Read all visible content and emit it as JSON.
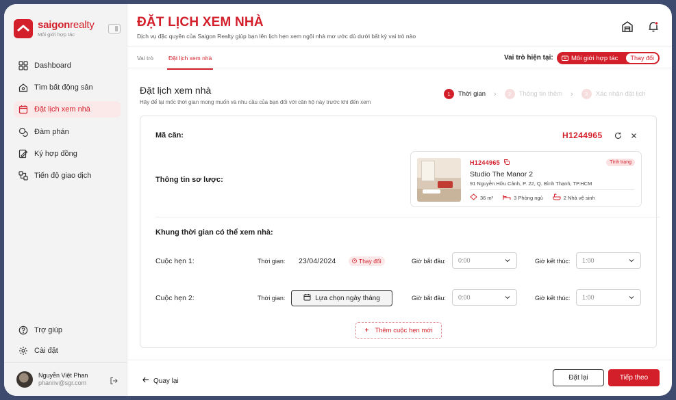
{
  "sidebar": {
    "brand_bold": "saigon",
    "brand_light": "realty",
    "brand_sub": "Môi giới hợp tác",
    "nav": [
      {
        "label": "Dashboard",
        "icon": "grid-icon"
      },
      {
        "label": "Tìm bất động sản",
        "icon": "house-search-icon"
      },
      {
        "label": "Đặt lịch xem nhà",
        "icon": "calendar-icon",
        "active": true
      },
      {
        "label": "Đàm phán",
        "icon": "chat-icon"
      },
      {
        "label": "Ký hợp đồng",
        "icon": "signature-icon"
      },
      {
        "label": "Tiến độ giao dịch",
        "icon": "progress-icon"
      }
    ],
    "bottom": [
      {
        "label": "Trợ giúp",
        "icon": "help-icon"
      },
      {
        "label": "Cài đặt",
        "icon": "gear-icon"
      }
    ],
    "user": {
      "name": "Nguyễn Việt Phan",
      "email": "phannv@sgr.com"
    }
  },
  "header": {
    "title": "ĐẶT LỊCH XEM NHÀ",
    "subtitle": "Dịch vụ đặc quyền của Saigon Realty giúp bạn lên lịch hẹn xem ngôi nhà mơ ước dù dưới bất kỳ vai trò nào"
  },
  "tabs": [
    {
      "label": "Vai trò"
    },
    {
      "label": "Đặt lịch xem nhà",
      "active": true
    }
  ],
  "role": {
    "label": "Vai trò hiện tại:",
    "value": "Môi giới hợp tác",
    "change": "Thay đổi"
  },
  "section": {
    "title": "Đặt lịch xem nhà",
    "subtitle": "Hãy để lại mốc thời gian mong muốn và nhu cầu của bạn đối với căn hộ này trước khi đến xem"
  },
  "steps": [
    {
      "num": "1",
      "label": "Thời gian",
      "active": true
    },
    {
      "num": "2",
      "label": "Thông tin thêm",
      "active": false
    },
    {
      "num": "3",
      "label": "Xác nhận đặt lịch",
      "active": false
    }
  ],
  "form": {
    "code_label": "Mã căn:",
    "code_value": "H1244965",
    "info_label": "Thông tin sơ lược:",
    "property": {
      "code": "H1244965",
      "badge": "Tình trạng",
      "name": "Studio The Manor 2",
      "address": "91 Nguyễn Hữu Cảnh, P. 22, Q. Bình Thạnh, TP.HCM",
      "area": "36 m²",
      "bedrooms": "3 Phòng ngủ",
      "bathrooms": "2 Nhà vệ sinh"
    },
    "slots_label": "Khung thời gian có thể xem nhà:",
    "appointments": [
      {
        "label": "Cuộc hẹn 1:",
        "time_label": "Thời gian:",
        "date": "23/04/2024",
        "change": "Thay đổi",
        "start_label": "Giờ bắt đầu:",
        "start_value": "0:00",
        "end_label": "Giờ kết thúc:",
        "end_value": "1:00"
      },
      {
        "label": "Cuộc hẹn 2:",
        "time_label": "Thời gian:",
        "pick_label": "Lựa chọn ngày tháng",
        "start_label": "Giờ bắt đầu:",
        "start_value": "0:00",
        "end_label": "Giờ kết thúc:",
        "end_value": "1:00"
      }
    ],
    "add_label": "Thêm cuộc hẹn mới"
  },
  "footer": {
    "back": "Quay lại",
    "reset": "Đặt lại",
    "next": "Tiếp theo"
  },
  "colors": {
    "accent": "#d31f2a",
    "sidebar_bg": "#f3f3f3",
    "frame_bg": "#3f4b6e"
  }
}
